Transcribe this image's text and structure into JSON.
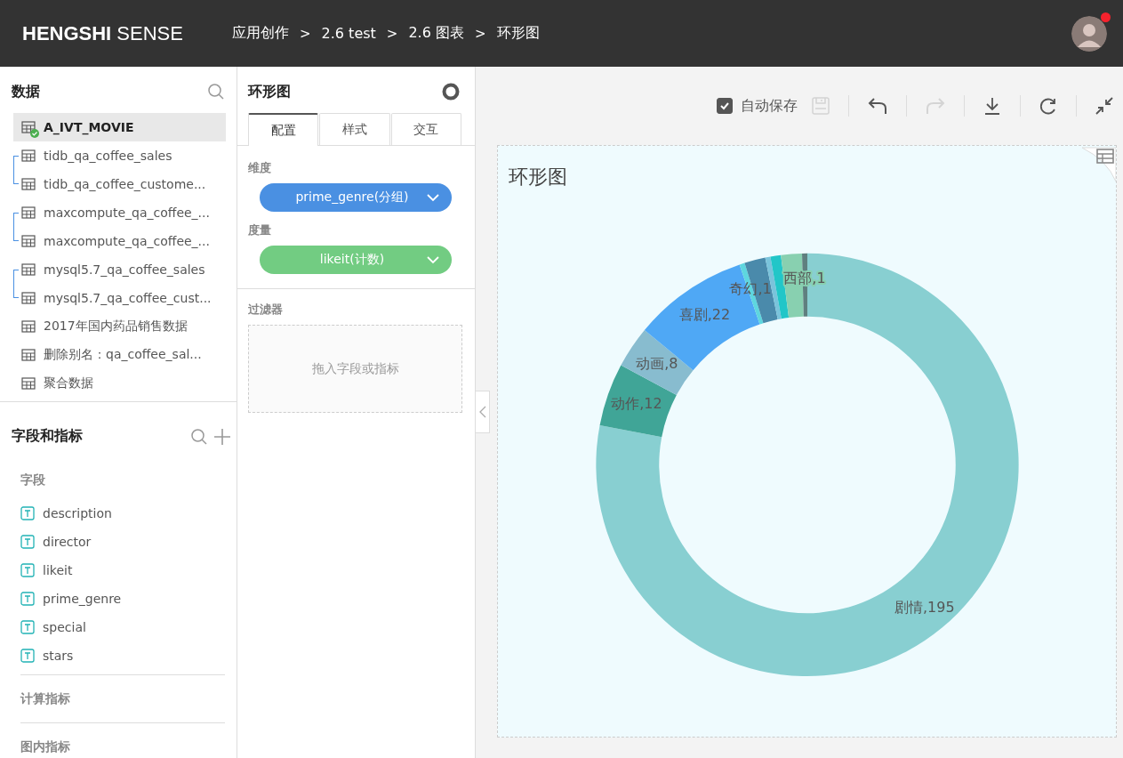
{
  "header": {
    "logo": "**HENGSHI** SENSE",
    "separator": ">",
    "breadcrumb": [
      "应用创作",
      "2.6 test",
      "2.6 图表",
      "环形图"
    ],
    "notification": true
  },
  "data_panel": {
    "title": "数据",
    "groups": [
      {
        "tables": [
          {
            "name": "A_IVT_MOVIE",
            "selected": true,
            "connected": true
          }
        ]
      },
      {
        "tables": [
          {
            "name": "tidb_qa_coffee_sales",
            "selected": false,
            "connected": false
          },
          {
            "name": "tidb_qa_coffee_custome...",
            "selected": false,
            "connected": false
          }
        ]
      },
      {
        "tables": [
          {
            "name": "maxcompute_qa_coffee_...",
            "selected": false,
            "connected": false
          },
          {
            "name": "maxcompute_qa_coffee_...",
            "selected": false,
            "connected": false
          }
        ]
      },
      {
        "tables": [
          {
            "name": "mysql5.7_qa_coffee_sales",
            "selected": false,
            "connected": false
          },
          {
            "name": "mysql5.7_qa_coffee_cust...",
            "selected": false,
            "connected": false
          }
        ]
      },
      {
        "tables": [
          {
            "name": "2017年国内药品销售数据",
            "selected": false,
            "connected": false
          }
        ]
      },
      {
        "tables": [
          {
            "name": "删除别名：qa_coffee_sal...",
            "selected": false,
            "connected": false
          }
        ]
      },
      {
        "tables": [
          {
            "name": "聚合数据",
            "selected": false,
            "connected": false
          }
        ]
      }
    ]
  },
  "fields_panel": {
    "title": "字段和指标",
    "sections": [
      {
        "title": "字段",
        "fields": [
          {
            "name": "description",
            "kind": "text"
          },
          {
            "name": "director",
            "kind": "text"
          },
          {
            "name": "likeit",
            "kind": "text"
          },
          {
            "name": "prime_genre",
            "kind": "text"
          },
          {
            "name": "special",
            "kind": "text"
          },
          {
            "name": "stars",
            "kind": "text"
          }
        ]
      },
      {
        "title": "计算指标"
      },
      {
        "title": "图内指标"
      }
    ]
  },
  "config_panel": {
    "title": "环形图",
    "tabs": [
      {
        "label": "配置",
        "selected": true
      },
      {
        "label": "样式",
        "selected": false
      },
      {
        "label": "交互",
        "selected": false
      }
    ],
    "slots": [
      {
        "label": "维度",
        "pill": "prime_genre(分组)",
        "color": "#4a90e2"
      },
      {
        "label": "度量",
        "pill": "likeit(计数)",
        "color": "#72cc82"
      }
    ],
    "filter": {
      "label": "过滤器",
      "placeholder": "拖入字段或指标"
    }
  },
  "toolbar": {
    "autosave": {
      "label": "自动保存",
      "checked": true
    },
    "save_disabled": true,
    "redo_disabled": true
  },
  "chart": {
    "title": "环形图",
    "chart_data": {
      "type": "donut",
      "categories": [
        "剧情,195",
        "动作,12",
        "动画,8",
        "喜剧,22",
        "奇幻,1",
        null,
        null,
        null,
        null,
        "西部,1"
      ],
      "values": [
        195,
        12,
        8,
        22,
        1,
        4,
        1,
        2,
        4,
        1
      ],
      "colors": [
        "#88cfd1",
        "#40a597",
        "#88bccf",
        "#4fa8f5",
        "#5ed6df",
        "#4a8aab",
        "#7ac3db",
        "#22c6c8",
        "#88d0b0",
        "#5f7f7f"
      ]
    }
  }
}
